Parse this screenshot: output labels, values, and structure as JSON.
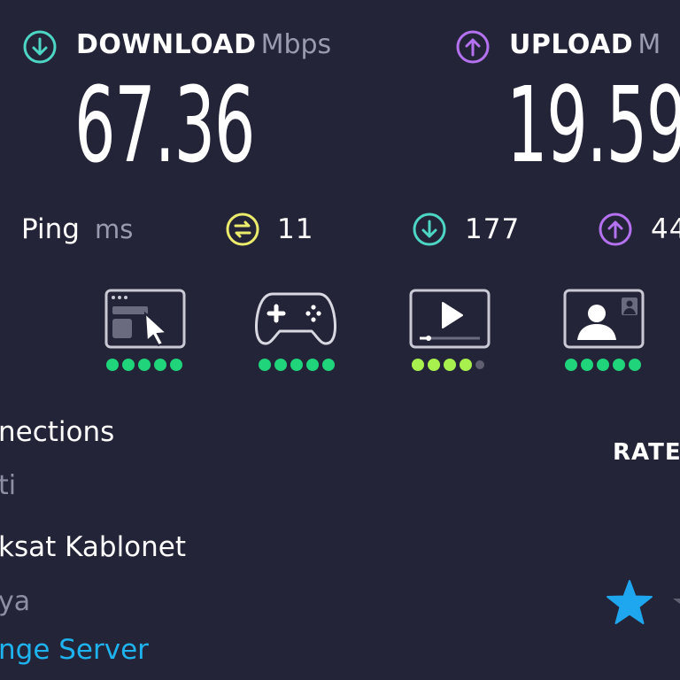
{
  "download": {
    "label": "DOWNLOAD",
    "unit": "Mbps",
    "value": "67.36",
    "icon": "download-arrow-icon",
    "color": "#4dd6c4"
  },
  "upload": {
    "label": "UPLOAD",
    "unit": "M",
    "value": "19.59",
    "icon": "upload-arrow-icon",
    "color": "#b472f0"
  },
  "ping": {
    "label": "Ping",
    "unit": "ms",
    "idle": {
      "value": "11",
      "icon": "idle-latency-icon",
      "color": "#ecec6c"
    },
    "download": {
      "value": "177",
      "icon": "download-latency-icon",
      "color": "#4dd6c4"
    },
    "upload": {
      "value": "44",
      "icon": "upload-latency-icon",
      "color": "#b472f0"
    }
  },
  "quality": [
    {
      "name": "browsing",
      "icon": "web-browsing-icon",
      "rating": 5,
      "max": 5,
      "dot_color": "#1fd47a"
    },
    {
      "name": "gaming",
      "icon": "gamepad-icon",
      "rating": 5,
      "max": 5,
      "dot_color": "#1fd47a"
    },
    {
      "name": "streaming",
      "icon": "video-player-icon",
      "rating": 4,
      "max": 5,
      "dot_color": "#a8f04e"
    },
    {
      "name": "video-chat",
      "icon": "video-call-icon",
      "rating": 5,
      "max": 5,
      "dot_color": "#1fd47a"
    }
  ],
  "connection": {
    "heading": "nections",
    "type": "ti",
    "isp": "ksat Kablonet",
    "location": "ya",
    "change_server": "nge Server"
  },
  "rate": {
    "label": "RATE",
    "star_icon": "star-icon",
    "star_color": "#1ea6ee"
  }
}
